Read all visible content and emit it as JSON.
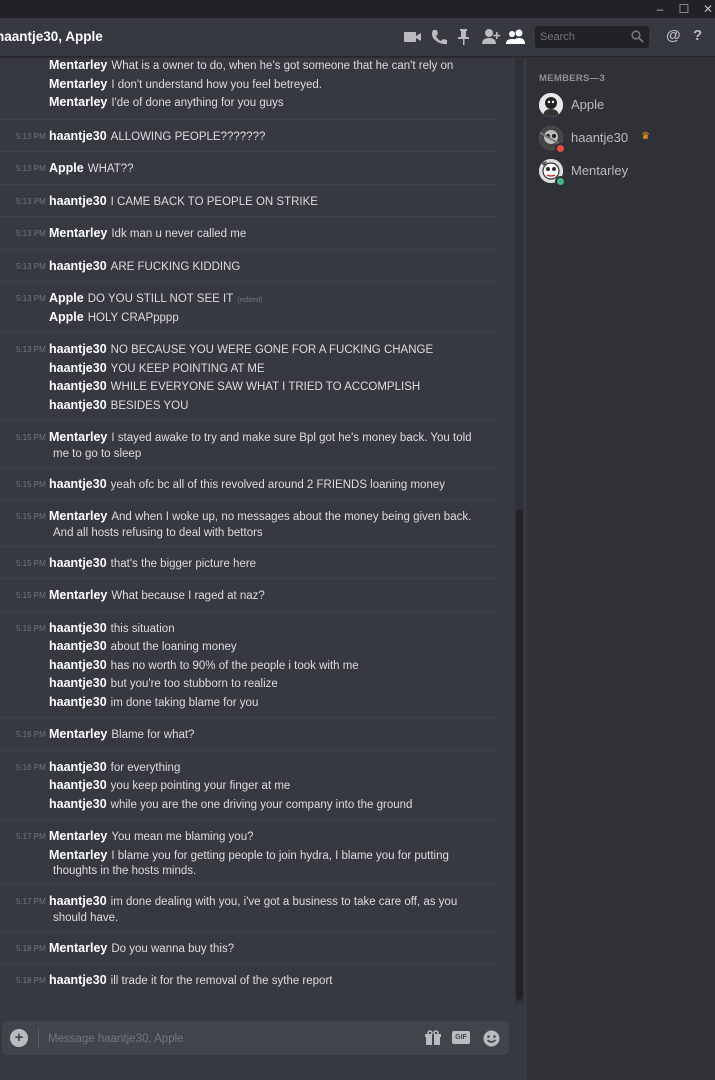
{
  "window": {
    "minimize": "–",
    "maximize": "☐",
    "close": "✕"
  },
  "header": {
    "title": "haantje30, Apple",
    "search_placeholder": "Search",
    "mention_symbol": "@",
    "help_symbol": "?"
  },
  "members": {
    "heading": "MEMBERS—3",
    "list": [
      {
        "name": "Apple",
        "status": "none",
        "owner": false
      },
      {
        "name": "haantje30",
        "status": "dnd",
        "owner": true
      },
      {
        "name": "Mentarley",
        "status": "online",
        "owner": false
      }
    ],
    "crown": "♛"
  },
  "composer": {
    "placeholder": "Message haantje30, Apple",
    "gif": "GIF"
  },
  "messages": [
    {
      "time": "",
      "lines": [
        {
          "author": "Mentarley",
          "text": "What is a owner to do, when he's got someone that he can't rely on"
        },
        {
          "author": "Mentarley",
          "text": "I don't understand how you feel betreyed."
        },
        {
          "author": "Mentarley",
          "text": "I'de of done anything for you guys"
        }
      ]
    },
    {
      "time": "5:13 PM",
      "lines": [
        {
          "author": "haantje30",
          "text": "ALLOWING PEOPLE???????"
        }
      ]
    },
    {
      "time": "5:13 PM",
      "lines": [
        {
          "author": "Apple",
          "text": "WHAT??"
        }
      ]
    },
    {
      "time": "5:13 PM",
      "lines": [
        {
          "author": "haantje30",
          "text": "I CAME BACK  TO PEOPLE ON STRIKE"
        }
      ]
    },
    {
      "time": "5:13 PM",
      "lines": [
        {
          "author": "Mentarley",
          "text": "Idk man u never called me"
        }
      ]
    },
    {
      "time": "5:13 PM",
      "lines": [
        {
          "author": "haantje30",
          "text": "ARE FUCKING KIDDING"
        }
      ]
    },
    {
      "time": "5:13 PM",
      "lines": [
        {
          "author": "Apple",
          "text": "DO YOU STILL NOT SEE IT",
          "edited": "(edited)"
        },
        {
          "author": "Apple",
          "text": "HOLY CRAPpppp"
        }
      ]
    },
    {
      "time": "5:13 PM",
      "lines": [
        {
          "author": "haantje30",
          "text": "NO BECAUSE YOU WERE GONE FOR A FUCKING CHANGE"
        },
        {
          "author": "haantje30",
          "text": "YOU KEEP POINTING AT ME"
        },
        {
          "author": "haantje30",
          "text": "WHILE EVERYONE SAW WHAT I TRIED TO ACCOMPLISH"
        },
        {
          "author": "haantje30",
          "text": "BESIDES YOU"
        }
      ]
    },
    {
      "time": "5:15 PM",
      "lines": [
        {
          "author": "Mentarley",
          "text": "I stayed awake to try and make sure Bpl got he's money back. You told",
          "cont": "me to go to sleep"
        }
      ]
    },
    {
      "time": "5:15 PM",
      "lines": [
        {
          "author": "haantje30",
          "text": "yeah ofc bc all of this revolved around 2 FRIENDS loaning money"
        }
      ]
    },
    {
      "time": "5:15 PM",
      "lines": [
        {
          "author": "Mentarley",
          "text": "And when I woke up, no messages about the money being given back.",
          "cont": "And all hosts refusing to deal with bettors"
        }
      ]
    },
    {
      "time": "5:15 PM",
      "lines": [
        {
          "author": "haantje30",
          "text": "that's the bigger picture here"
        }
      ]
    },
    {
      "time": "5:15 PM",
      "lines": [
        {
          "author": "Mentarley",
          "text": "What because I raged at naz?"
        }
      ]
    },
    {
      "time": "5:16 PM",
      "lines": [
        {
          "author": "haantje30",
          "text": "this situation"
        },
        {
          "author": "haantje30",
          "text": "about the loaning money"
        },
        {
          "author": "haantje30",
          "text": "has no worth to 90% of the people i took with me"
        },
        {
          "author": "haantje30",
          "text": "but you're too stubborn to realize"
        },
        {
          "author": "haantje30",
          "text": "im done taking blame for you"
        }
      ]
    },
    {
      "time": "5:16 PM",
      "lines": [
        {
          "author": "Mentarley",
          "text": "Blame for what?"
        }
      ]
    },
    {
      "time": "5:16 PM",
      "lines": [
        {
          "author": "haantje30",
          "text": "for everything"
        },
        {
          "author": "haantje30",
          "text": "you keep pointing your finger at me"
        },
        {
          "author": "haantje30",
          "text": "while you are the one driving your company into the ground"
        }
      ]
    },
    {
      "time": "5:17 PM",
      "lines": [
        {
          "author": "Mentarley",
          "text": "You mean me blaming you?"
        },
        {
          "author": "Mentarley",
          "text": "I blame you for getting people to join hydra, I blame you for putting",
          "cont": "thoughts in the hosts minds."
        }
      ]
    },
    {
      "time": "5:17 PM",
      "lines": [
        {
          "author": "haantje30",
          "text": "im done dealing with you, i've got a business to take care off, as you",
          "cont": "should have."
        }
      ]
    },
    {
      "time": "5:18 PM",
      "lines": [
        {
          "author": "Mentarley",
          "text": "Do you wanna buy this?"
        }
      ]
    },
    {
      "time": "5:18 PM",
      "lines": [
        {
          "author": "haantje30",
          "text": "ill trade it for the removal of the sythe report"
        }
      ]
    }
  ]
}
